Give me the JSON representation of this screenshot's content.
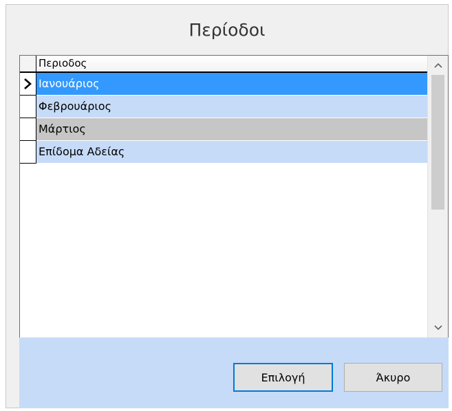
{
  "dialog": {
    "title": "Περίοδοι"
  },
  "grid": {
    "column_header": "Περιοδος",
    "rows": [
      {
        "label": "Ιανουάριος",
        "state": "selected",
        "current": true
      },
      {
        "label": "Φεβρουάριος",
        "state": "alt",
        "current": false
      },
      {
        "label": "Μάρτιος",
        "state": "grey",
        "current": false
      },
      {
        "label": "Επίδομα Αδείας",
        "state": "alt",
        "current": false
      }
    ],
    "current_row_icon": "row-pointer-icon",
    "scroll_up_icon": "chevron-up-icon",
    "scroll_down_icon": "chevron-down-icon"
  },
  "buttons": {
    "select_label": "Επιλογή",
    "cancel_label": "Άκυρο"
  },
  "colors": {
    "selected_row": "#3399ff",
    "alt_row": "#c6dbf7",
    "grey_row": "#c6c6c6",
    "footer": "#c6dbf7",
    "default_button_border": "#0078d7"
  }
}
